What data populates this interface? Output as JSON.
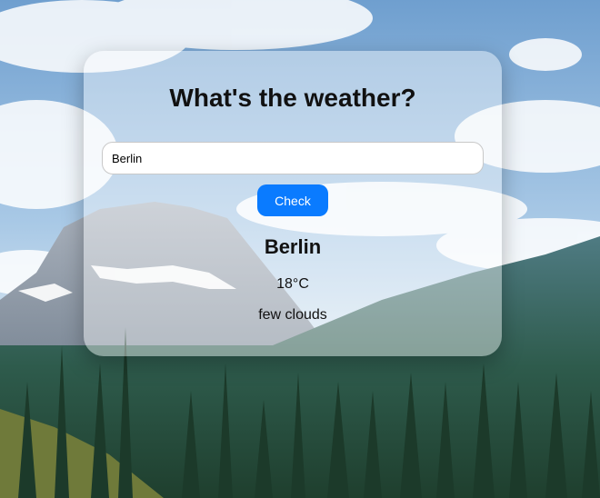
{
  "card": {
    "title": "What's the weather?",
    "city_input_value": "Berlin",
    "check_label": "Check"
  },
  "result": {
    "city": "Berlin",
    "temperature": "18°C",
    "description": "few clouds"
  },
  "colors": {
    "button": "#0a7bff",
    "sky": "#8fb7da",
    "forest": "#2f5a45"
  }
}
